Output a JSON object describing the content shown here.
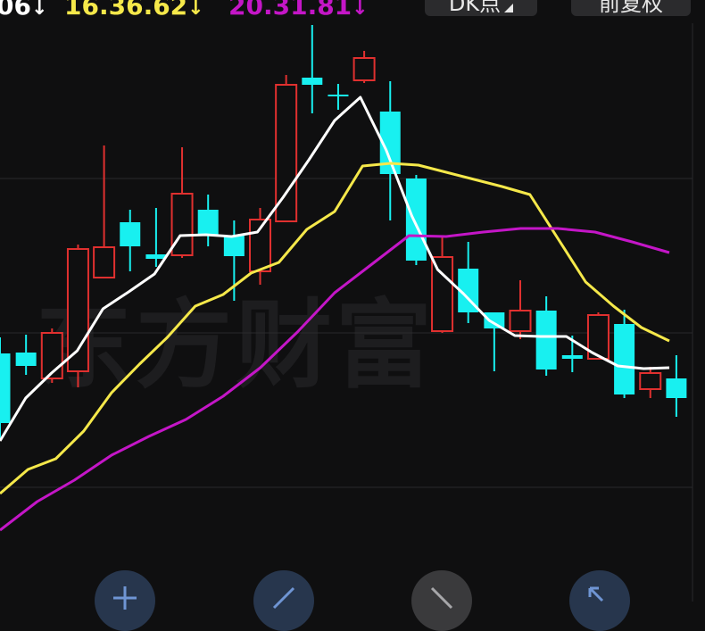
{
  "legend": {
    "ma5": {
      "text": "06",
      "arrow": "↓",
      "color": "#ffffff"
    },
    "ma10": {
      "text": "16.36.62",
      "arrow": "↓",
      "color": "#f5e84a"
    },
    "ma20": {
      "text": "20.31.81",
      "arrow": "↓",
      "color": "#c416c7"
    }
  },
  "toolbar": {
    "period_label": "DK点",
    "adjust_label": "前复权"
  },
  "watermark": "东方财富",
  "colors": {
    "up": "#e0302f",
    "down": "#18f0f0",
    "grid": "#2a2a2c",
    "background": "#0f0f10",
    "button_blue": "#27364d"
  },
  "icons": [
    "zoom-in-icon",
    "draw-line-icon",
    "draw-ray-icon",
    "fullscreen-icon"
  ],
  "chart_data": {
    "type": "candlestick",
    "grid": true,
    "ylim": [
      0,
      674
    ],
    "candles": [
      {
        "open": 278,
        "close": 200,
        "high": 296,
        "low": 182
      },
      {
        "open": 279,
        "close": 264,
        "high": 299,
        "low": 254
      },
      {
        "open": 250,
        "close": 301,
        "high": 306,
        "low": 245
      },
      {
        "open": 258,
        "close": 395,
        "high": 400,
        "low": 240
      },
      {
        "open": 363,
        "close": 397,
        "high": 511,
        "low": 364
      },
      {
        "open": 425,
        "close": 398,
        "high": 439,
        "low": 370
      },
      {
        "open": 389,
        "close": 384,
        "high": 441,
        "low": 375
      },
      {
        "open": 388,
        "close": 457,
        "high": 509,
        "low": 385
      },
      {
        "open": 439,
        "close": 410,
        "high": 456,
        "low": 398
      },
      {
        "open": 410,
        "close": 387,
        "high": 427,
        "low": 337
      },
      {
        "open": 370,
        "close": 428,
        "high": 441,
        "low": 355
      },
      {
        "open": 426,
        "close": 579,
        "high": 590,
        "low": 426
      },
      {
        "open": 587,
        "close": 579,
        "high": 646,
        "low": 547
      },
      {
        "open": 568,
        "close": 567,
        "high": 580,
        "low": 551
      },
      {
        "open": 584,
        "close": 609,
        "high": 617,
        "low": 581
      },
      {
        "open": 549,
        "close": 479,
        "high": 583,
        "low": 427
      },
      {
        "open": 474,
        "close": 382,
        "high": 478,
        "low": 377
      },
      {
        "open": 303,
        "close": 386,
        "high": 409,
        "low": 301
      },
      {
        "open": 373,
        "close": 324,
        "high": 403,
        "low": 312
      },
      {
        "open": 324,
        "close": 306,
        "high": 324,
        "low": 258
      },
      {
        "open": 303,
        "close": 326,
        "high": 360,
        "low": 294
      },
      {
        "open": 326,
        "close": 260,
        "high": 342,
        "low": 253
      },
      {
        "open": 276,
        "close": 272,
        "high": 298,
        "low": 257
      },
      {
        "open": 272,
        "close": 321,
        "high": 324,
        "low": 272
      },
      {
        "open": 311,
        "close": 232,
        "high": 327,
        "low": 228
      },
      {
        "open": 238,
        "close": 256,
        "high": 263,
        "low": 228
      },
      {
        "open": 250,
        "close": 228,
        "high": 276,
        "low": 207
      }
    ],
    "series": [
      {
        "name": "MA5",
        "color": "#ffffff",
        "values": [
          180,
          228,
          256,
          281,
          328,
          347,
          367,
          410,
          411,
          409,
          414,
          453,
          495,
          539,
          565,
          506,
          432,
          372,
          345,
          315,
          298,
          297,
          297,
          279,
          264,
          261,
          262
        ]
      },
      {
        "name": "MA10",
        "color": "#f5e84a",
        "values": [
          121,
          148,
          160,
          191,
          234,
          266,
          296,
          331,
          344,
          368,
          380,
          417,
          437,
          488,
          491,
          489,
          481,
          473,
          465,
          456,
          407,
          358,
          331,
          307,
          292
        ]
      },
      {
        "name": "MA20",
        "color": "#c416c7",
        "values": [
          80,
          112,
          136,
          164,
          185,
          204,
          230,
          262,
          302,
          346,
          378,
          410,
          409,
          414,
          418,
          418,
          414,
          403,
          391
        ]
      }
    ]
  }
}
